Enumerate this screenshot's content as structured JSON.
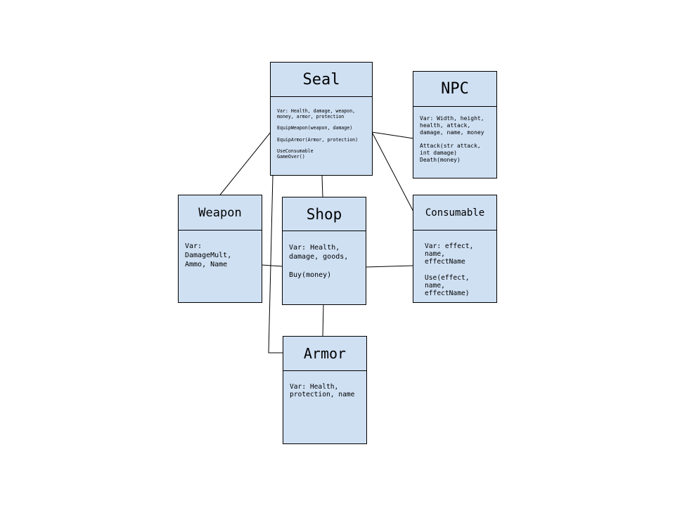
{
  "classes": {
    "seal": {
      "name": "Seal",
      "vars": "Var: Health, damage, weapon,\nmoney, armor, protection",
      "methods": [
        "EquipWeapon(weapon, damage)",
        "EquipArmor(Armor, protection)",
        "UseConsumable\nGameOver()"
      ]
    },
    "npc": {
      "name": "NPC",
      "vars": "Var: Width, height,\nhealth, attack,\ndamage, name, money",
      "methods": [
        "Attack(str attack,\nint damage)\nDeath(money)"
      ]
    },
    "weapon": {
      "name": "Weapon",
      "vars": "Var:\nDamageMult,\nAmmo, Name"
    },
    "shop": {
      "name": "Shop",
      "vars": "Var: Health,\ndamage, goods,",
      "methods": [
        "Buy(money)"
      ]
    },
    "consumable": {
      "name": "Consumable",
      "vars": "Var: effect,\nname,\neffectName",
      "methods": [
        "Use(effect,\nname,\neffectName)"
      ]
    },
    "armor": {
      "name": "Armor",
      "vars": "Var: Health,\nprotection, name"
    }
  },
  "colors": {
    "box_fill": "#cfe0f3",
    "stroke": "#000000"
  }
}
